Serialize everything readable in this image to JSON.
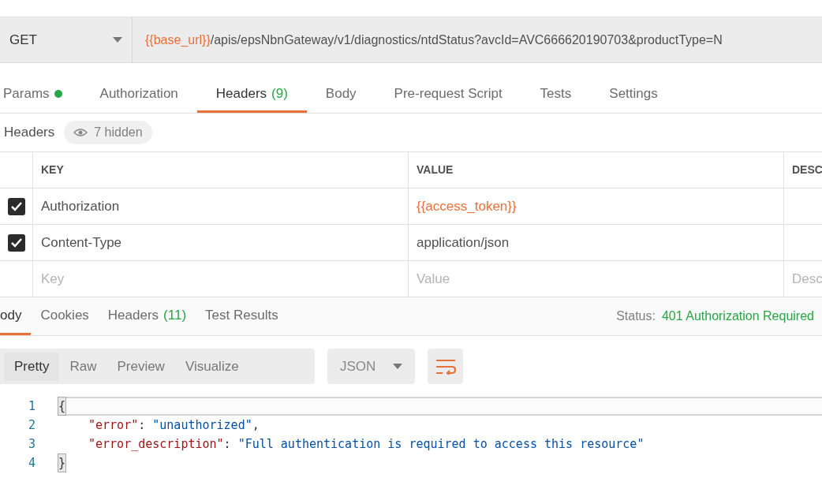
{
  "request": {
    "method": "GET",
    "url_variable": "{{base_url}}",
    "url_path": "/apis/epsNbnGateway/v1/diagnostics/ntdStatus?avcId=AVC666620190703&productType=N"
  },
  "request_tabs": [
    {
      "label": "Params",
      "indicator": true,
      "selected": false
    },
    {
      "label": "Authorization",
      "selected": false
    },
    {
      "label": "Headers",
      "count": "(9)",
      "selected": true
    },
    {
      "label": "Body",
      "selected": false
    },
    {
      "label": "Pre-request Script",
      "selected": false
    },
    {
      "label": "Tests",
      "selected": false
    },
    {
      "label": "Settings",
      "selected": false
    }
  ],
  "headers_bar": {
    "title": "Headers",
    "hidden": "7 hidden"
  },
  "headers_table": {
    "columns": [
      "KEY",
      "VALUE",
      "DESC"
    ],
    "rows": [
      {
        "checked": true,
        "key": "Authorization",
        "value": "{{access_token}}",
        "variable": true
      },
      {
        "checked": true,
        "key": "Content-Type",
        "value": "application/json",
        "variable": false
      }
    ],
    "new_row": [
      {
        "placeholder": "Key"
      },
      {
        "placeholder": "Value"
      },
      {
        "placeholder": "Desc"
      }
    ]
  },
  "response_tabs": [
    {
      "label": "ody",
      "selected": true
    },
    {
      "label": "Cookies",
      "selected": false
    },
    {
      "label": "Headers",
      "count": "(11)",
      "selected": false
    },
    {
      "label": "Test Results",
      "selected": false
    }
  ],
  "status": {
    "label": "Status:",
    "value": "401 Authorization Required"
  },
  "view_modes": [
    {
      "label": "Pretty",
      "selected": true
    },
    {
      "label": "Raw",
      "selected": false
    },
    {
      "label": "Preview",
      "selected": false
    },
    {
      "label": "Visualize",
      "selected": false
    }
  ],
  "format": "JSON",
  "code": [
    {
      "number": "1",
      "active": true,
      "tokens": [
        {
          "kind": "brace",
          "text": "{",
          "matched": true
        }
      ]
    },
    {
      "number": "2",
      "active": false,
      "indented": true,
      "tokens": [
        {
          "kind": "key",
          "text": "\"error\""
        },
        {
          "kind": "punct",
          "text": ": "
        },
        {
          "kind": "string",
          "text": "\"unauthorized\""
        },
        {
          "kind": "punct",
          "text": ","
        }
      ]
    },
    {
      "number": "3",
      "active": false,
      "indented": true,
      "tokens": [
        {
          "kind": "key",
          "text": "\"error_description\""
        },
        {
          "kind": "punct",
          "text": ": "
        },
        {
          "kind": "string",
          "text": "\"Full authentication is required to access this resource\""
        }
      ]
    },
    {
      "number": "4",
      "active": false,
      "tokens": [
        {
          "kind": "brace",
          "text": "}",
          "matched": true
        }
      ]
    }
  ]
}
